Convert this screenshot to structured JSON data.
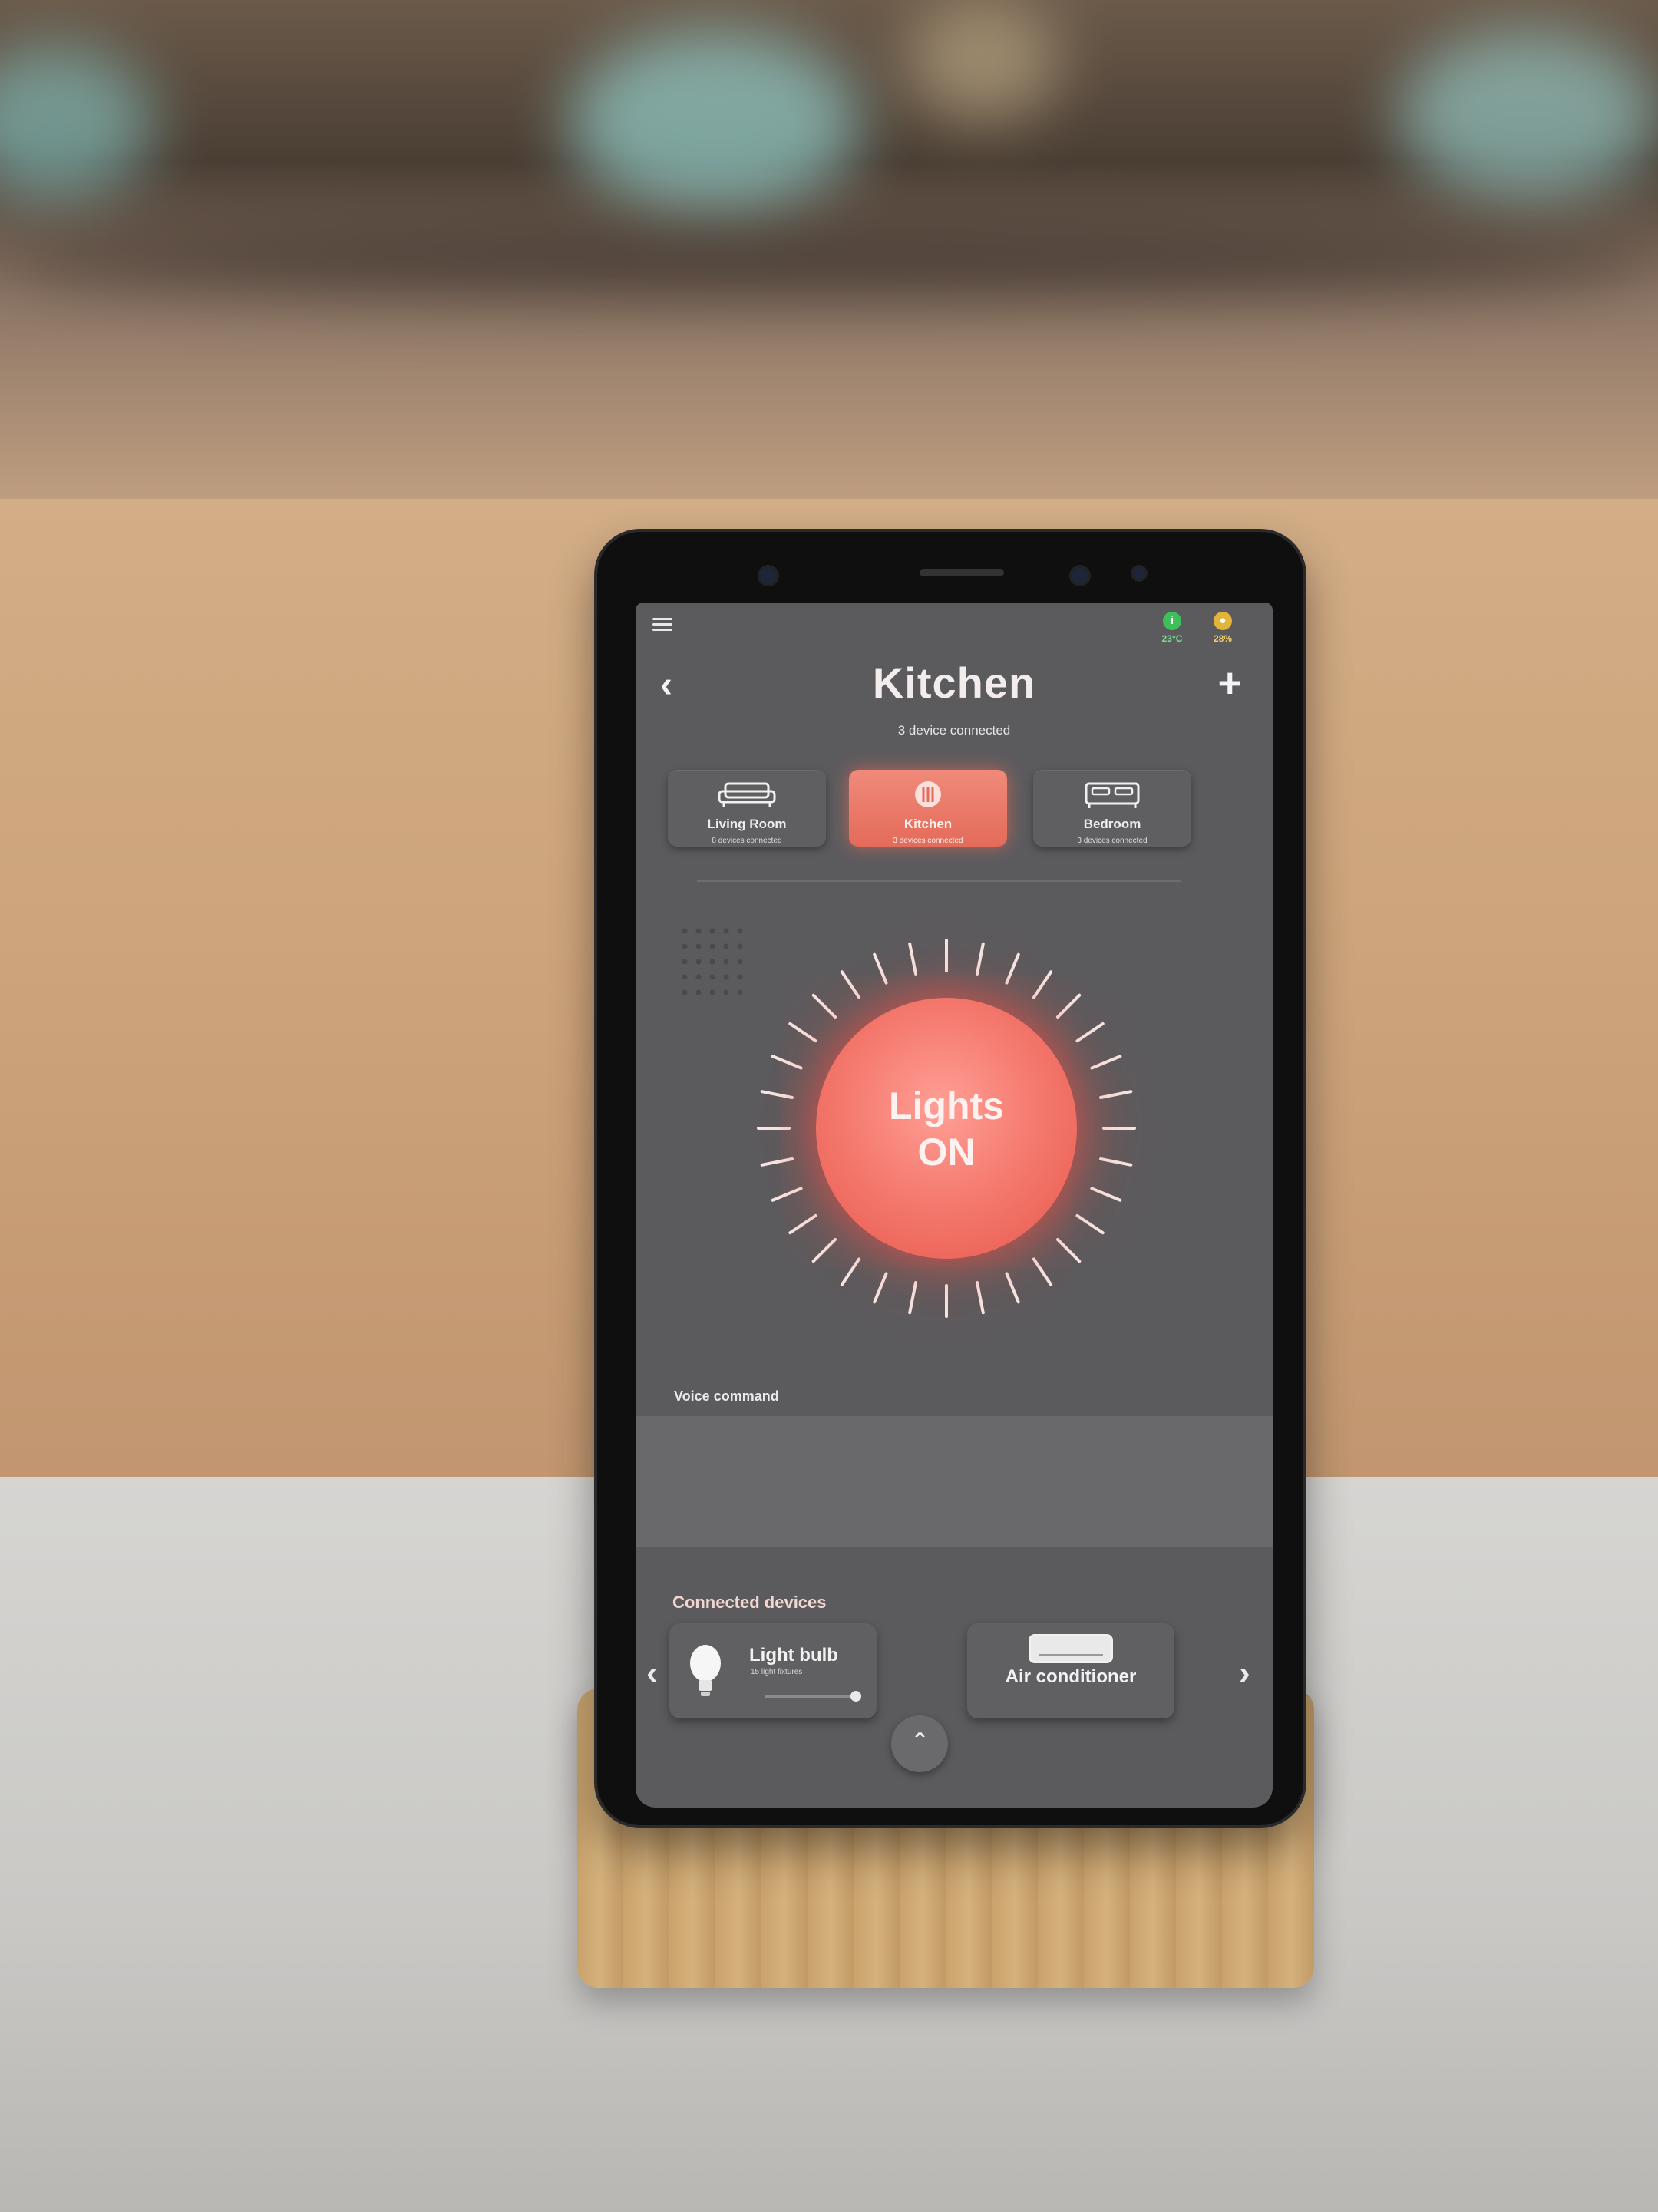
{
  "status": {
    "temperature": "23°C",
    "humidity": "28%",
    "temp_color": "#3fbf5a",
    "humidity_color": "#e2b43a"
  },
  "header": {
    "title": "Kitchen",
    "subtitle": "3 device connected",
    "back_icon": "chevron-left-icon",
    "add_icon": "plus-icon",
    "menu_icon": "hamburger-menu-icon"
  },
  "rooms": [
    {
      "label": "Living Room",
      "count": "8 devices connected",
      "icon": "sofa-icon",
      "active": false
    },
    {
      "label": "Kitchen",
      "count": "3 devices connected",
      "icon": "cutlery-icon",
      "active": true
    },
    {
      "label": "Bedroom",
      "count": "3 devices connected",
      "icon": "bed-icon",
      "active": false
    }
  ],
  "lamp": {
    "line1": "Lights",
    "line2": "ON",
    "color": "#f57b70"
  },
  "voice": {
    "label": "Voice command"
  },
  "devices": {
    "label": "Connected devices",
    "items": [
      {
        "title": "Light bulb",
        "sub": "15 light fixtures",
        "icon": "light-bulb-icon"
      },
      {
        "title": "Air conditioner",
        "icon": "air-conditioner-icon"
      }
    ]
  },
  "accent": "#e46b5a"
}
